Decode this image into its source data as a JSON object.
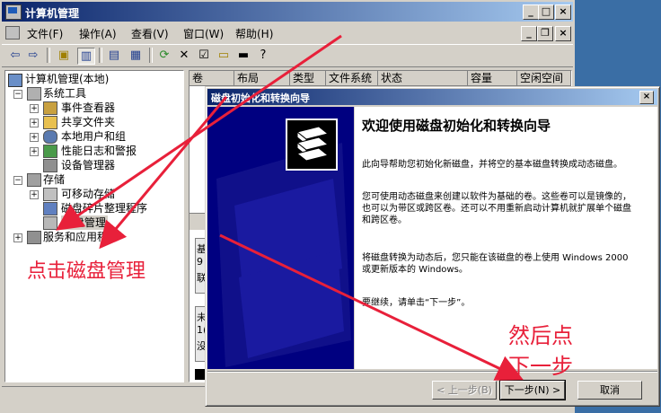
{
  "main_window": {
    "title": "计算机管理",
    "controls": {
      "minimize": "_",
      "maximize": "□",
      "close": "×"
    },
    "menu": [
      "文件(F)",
      "操作(A)",
      "查看(V)",
      "窗口(W)",
      "帮助(H)"
    ],
    "mdi_controls": {
      "minimize": "_",
      "restore": "❐",
      "close": "×"
    }
  },
  "tree": {
    "root": "计算机管理(本地)",
    "items": [
      {
        "label": "系统工具",
        "icon": "tools-icon"
      },
      {
        "label": "事件查看器",
        "icon": "event-viewer-icon"
      },
      {
        "label": "共享文件夹",
        "icon": "shared-folder-icon"
      },
      {
        "label": "本地用户和组",
        "icon": "users-icon"
      },
      {
        "label": "性能日志和警报",
        "icon": "performance-icon"
      },
      {
        "label": "设备管理器",
        "icon": "device-manager-icon"
      },
      {
        "label": "存储",
        "icon": "storage-icon"
      },
      {
        "label": "可移动存储",
        "icon": "removable-storage-icon"
      },
      {
        "label": "磁盘碎片整理程序",
        "icon": "defrag-icon"
      },
      {
        "label": "磁盘管理",
        "icon": "disk-management-icon"
      },
      {
        "label": "服务和应用程序",
        "icon": "services-icon"
      }
    ]
  },
  "list": {
    "columns": [
      "卷",
      "布局",
      "类型",
      "文件系统",
      "状态",
      "容量",
      "空闲空间"
    ],
    "lower_fragments": [
      "基",
      "9",
      "联",
      "未",
      "1(",
      "没"
    ]
  },
  "wizard": {
    "title": "磁盘初始化和转换向导",
    "close": "×",
    "heading": "欢迎使用磁盘初始化和转换向导",
    "p1": "此向导帮助您初始化新磁盘，并将空的基本磁盘转换成动态磁盘。",
    "p2": "您可使用动态磁盘来创建以软件为基础的卷。这些卷可以是镜像的，也可以为带区或跨区卷。还可以不用重新启动计算机就扩展单个磁盘和跨区卷。",
    "p3": "将磁盘转换为动态后，您只能在该磁盘的卷上使用 Windows 2000 或更新版本的 Windows。",
    "p4": "要继续，请单击“下一步”。",
    "buttons": {
      "back": "< 上一步(B)",
      "next": "下一步(N) >",
      "cancel": "取消"
    }
  },
  "annotations": {
    "left": "点击磁盘管理",
    "right_line1": "然后点",
    "right_line2": "下一步",
    "color": "#e8203a"
  }
}
